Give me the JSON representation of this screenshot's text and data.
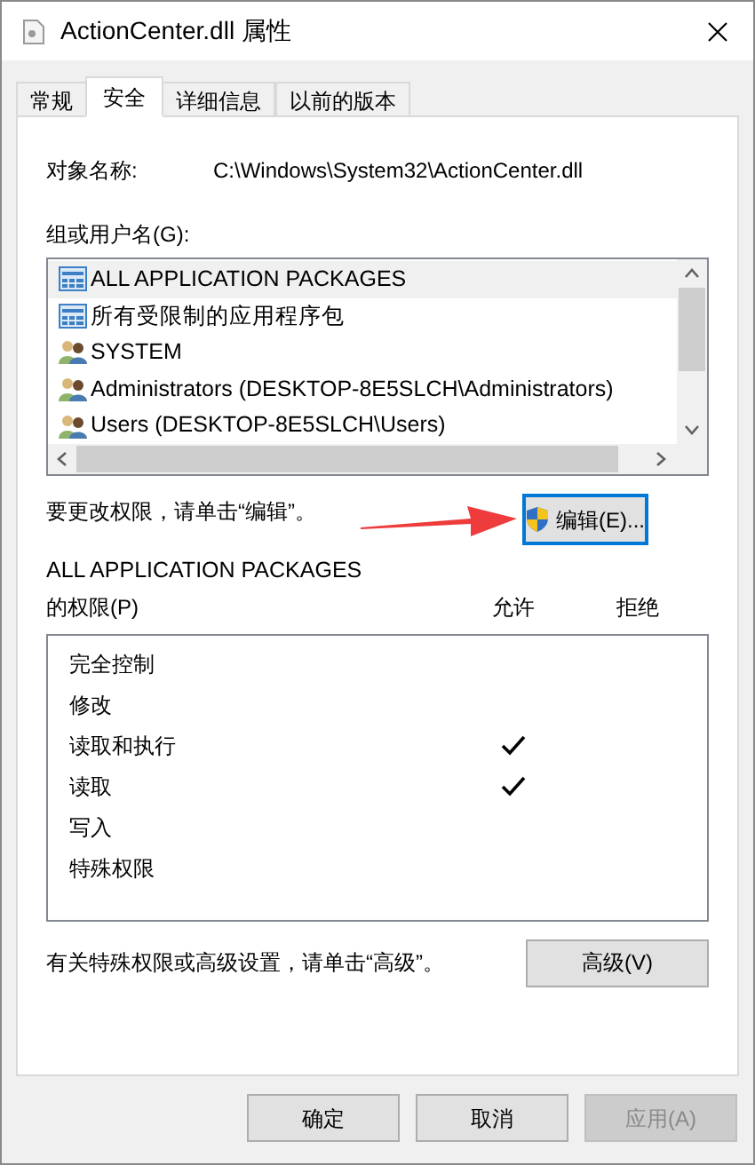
{
  "window": {
    "title": "ActionCenter.dll 属性"
  },
  "tabs": [
    {
      "label": "常规",
      "selected": false
    },
    {
      "label": "安全",
      "selected": true
    },
    {
      "label": "详细信息",
      "selected": false
    },
    {
      "label": "以前的版本",
      "selected": false
    }
  ],
  "object_name": {
    "label": "对象名称:",
    "value": "C:\\Windows\\System32\\ActionCenter.dll"
  },
  "groups": {
    "label": "组或用户名(G):",
    "items": [
      {
        "name": "ALL APPLICATION PACKAGES",
        "kind": "package",
        "selected": true
      },
      {
        "name": "所有受限制的应用程序包",
        "kind": "package",
        "selected": false
      },
      {
        "name": "SYSTEM",
        "kind": "users",
        "selected": false
      },
      {
        "name": "Administrators (DESKTOP-8E5SLCH\\Administrators)",
        "kind": "users",
        "selected": false
      },
      {
        "name": "Users (DESKTOP-8E5SLCH\\Users)",
        "kind": "users",
        "selected": false
      }
    ]
  },
  "edit_hint": "要更改权限，请单击“编辑”。",
  "edit_button": "编辑(E)...",
  "permissions": {
    "title_line1": "ALL APPLICATION PACKAGES",
    "title_line2": "的权限(P)",
    "allow_header": "允许",
    "deny_header": "拒绝",
    "rows": [
      {
        "name": "完全控制",
        "allow": false,
        "deny": false
      },
      {
        "name": "修改",
        "allow": false,
        "deny": false
      },
      {
        "name": "读取和执行",
        "allow": true,
        "deny": false
      },
      {
        "name": "读取",
        "allow": true,
        "deny": false
      },
      {
        "name": "写入",
        "allow": false,
        "deny": false
      },
      {
        "name": "特殊权限",
        "allow": false,
        "deny": false
      }
    ]
  },
  "advanced_hint": "有关特殊权限或高级设置，请单击“高级”。",
  "advanced_button": "高级(V)",
  "buttons": [
    {
      "label": "确定",
      "disabled": false
    },
    {
      "label": "取消",
      "disabled": false
    },
    {
      "label": "应用(A)",
      "disabled": true
    }
  ]
}
